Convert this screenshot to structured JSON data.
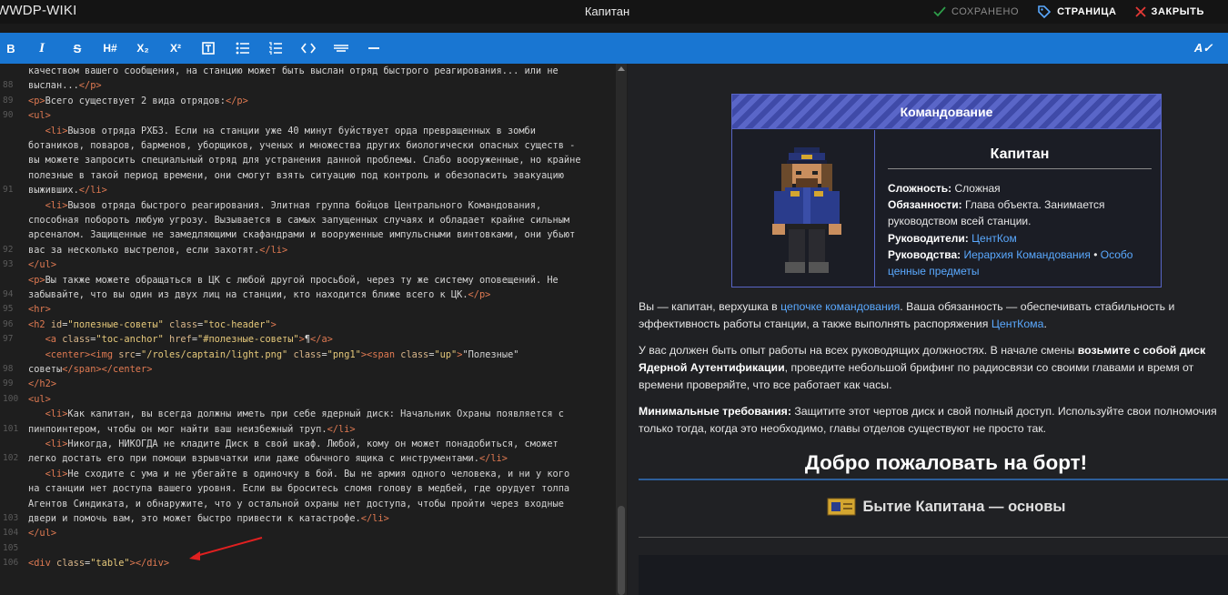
{
  "app": {
    "brand": "WWDP-WIKI",
    "page_title": "Капитан",
    "saved_label": "СОХРАНЕНО",
    "page_label": "СТРАНИЦА",
    "close_label": "ЗАКРЫТЬ"
  },
  "toolbar": {
    "bold": "B",
    "italic": "I",
    "strike": "S",
    "heading": "H#",
    "subscript": "X₂",
    "superscript": "X²",
    "spellcheck": "A✓"
  },
  "editor": {
    "line_numbers": [
      "",
      "88",
      "89",
      "90",
      "",
      "",
      "",
      "",
      "91",
      "",
      "",
      "",
      "92",
      "93",
      "",
      "94",
      "95",
      "96",
      "97",
      "",
      "98",
      "99",
      "100",
      "",
      "101",
      "",
      "102",
      "",
      "",
      "",
      "103",
      "104",
      "105",
      "106"
    ],
    "lines": [
      {
        "t": "качеством вашего сообщения, на станцию может быть выслан отряд быстрого реагирования... или не"
      },
      {
        "t": "выслан...",
        "tail": "</p>"
      },
      {
        "t": "<p>Всего существует 2 вида отрядов:</p>"
      },
      {
        "t": "<ul>"
      },
      {
        "t": "   <li>Вызов отряда РХБЗ. Если на станции уже 40 минут буйствует орда превращенных в зомби"
      },
      {
        "t": "ботаников, поваров, барменов, уборщиков, ученых и множества других биологически опасных существ -"
      },
      {
        "t": "вы можете запросить специальный отряд для устранения данной проблемы. Слабо вооруженные, но крайне"
      },
      {
        "t": "полезные в такой период времени, они смогут взять ситуацию под контроль и обезопасить эвакуацию"
      },
      {
        "t": "выживших.</li>"
      },
      {
        "t": "   <li>Вызов отряда быстрого реагирования. Элитная группа бойцов Центрального Командования,"
      },
      {
        "t": "способная побороть любую угрозу. Вызывается в самых запущенных случаях и обладает крайне сильным"
      },
      {
        "t": "арсеналом. Защищенные не замедляющими скафандрами и вооруженные импульсными винтовками, они убьют"
      },
      {
        "t": "вас за несколько выстрелов, если захотят.</li>"
      },
      {
        "t": "</ul>"
      },
      {
        "t": "<p>Вы также можете обращаться в ЦК с любой другой просьбой, через ту же систему оповещений. Не"
      },
      {
        "t": "забывайте, что вы один из двух лиц на станции, кто находится ближе всего к ЦК.</p>"
      },
      {
        "t": "<hr>"
      },
      {
        "t": "<h2 id=\"полезные-советы\" class=\"toc-header\">"
      },
      {
        "t": "   <a class=\"toc-anchor\" href=\"#полезные-советы\">¶</a>"
      },
      {
        "t": "   <center><img src=\"/roles/captain/light.png\" class=\"png1\"><span class=\"up\">\"Полезные\""
      },
      {
        "t": "советы</span></center>"
      },
      {
        "t": "</h2>"
      },
      {
        "t": "<ul>"
      },
      {
        "t": "   <li>Как капитан, вы всегда должны иметь при себе ядерный диск: Начальник Охраны появляется с"
      },
      {
        "t": "пинпоинтером, чтобы он мог найти ваш неизбежный труп.</li>"
      },
      {
        "t": "   <li>Никогда, НИКОГДА не кладите Диск в свой шкаф. Любой, кому он может понадобиться, сможет"
      },
      {
        "t": "легко достать его при помощи взрывчатки или даже обычного ящика с инструментами.</li>"
      },
      {
        "t": "   <li>Не сходите с ума и не убегайте в одиночку в бой. Вы не армия одного человека, и ни у кого"
      },
      {
        "t": "на станции нет доступа вашего уровня. Если вы броситесь сломя голову в медбей, где орудует толпа"
      },
      {
        "t": "Агентов Синдиката, и обнаружите, что у остальной охраны нет доступа, чтобы пройти через входные"
      },
      {
        "t": "двери и помочь вам, это может быстро привести к катастрофе.</li>"
      },
      {
        "t": "</ul>"
      },
      {
        "t": ""
      },
      {
        "t": "<div class=\"table\"></div>"
      },
      {
        "t": ""
      }
    ]
  },
  "preview": {
    "infobox": {
      "header": "Командование",
      "name": "Капитан",
      "difficulty_label": "Сложность:",
      "difficulty_value": "Сложная",
      "duties_label": "Обязанности:",
      "duties_value": "Глава объекта. Занимается руководством всей станции.",
      "supervisors_label": "Руководители:",
      "supervisors_value": "ЦентКом",
      "guides_label": "Руководства:",
      "guides_link1": "Иерархия Командования",
      "guides_sep": "•",
      "guides_link2": "Особо ценные предметы"
    },
    "p1_a": "Вы — капитан, верхушка в ",
    "p1_link": "цепочке командования",
    "p1_b": ". Ваша обязанность — обеспечивать стабильность и эффективность работы станции, а также выполнять распоряжения ",
    "p1_link2": "ЦентКома",
    "p1_c": ".",
    "p2_a": "У вас должен быть опыт работы на всех руководящих должностях. В начале смены ",
    "p2_b": "возьмите с собой диск Ядерной Аутентификации",
    "p2_c": ", проведите небольшой брифинг по радиосвязи со своими главами и время от времени проверяйте, что все работает как часы.",
    "p3_label": "Минимальные требования:",
    "p3_text": " Защитите этот чертов диск и свой полный доступ. Используйте свои полномочия только тогда, когда это необходимо, главы отделов существуют не просто так.",
    "h1": "Добро пожаловать на борт!",
    "h2": "Бытие Капитана — основы"
  },
  "colors": {
    "accent": "#1976d2",
    "link": "#5aa9ff",
    "tag": "#e07a52",
    "saved_check": "#2e9e4a",
    "close_x": "#e53935"
  }
}
